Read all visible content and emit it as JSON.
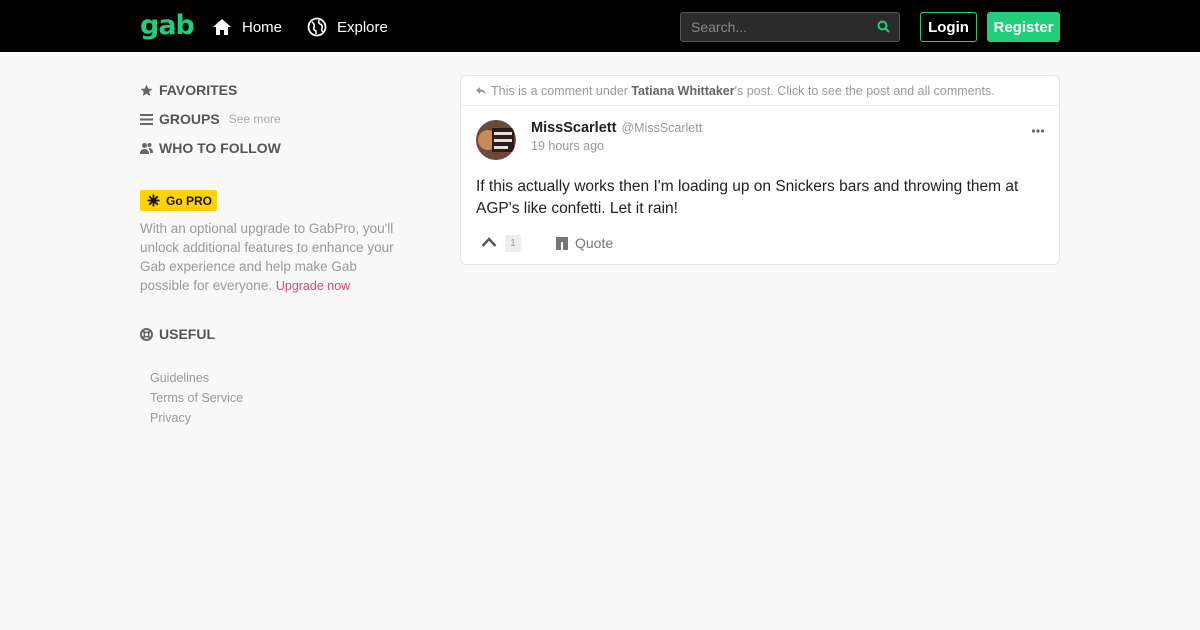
{
  "header": {
    "logo": "gab",
    "nav": [
      {
        "label": "Home",
        "icon": "home-icon"
      },
      {
        "label": "Explore",
        "icon": "globe-icon"
      }
    ],
    "search_placeholder": "Search...",
    "login_label": "Login",
    "register_label": "Register"
  },
  "sidebar": {
    "favorites": "FAVORITES",
    "groups": "GROUPS",
    "see_more": "See more",
    "who_to_follow": "WHO TO FOLLOW",
    "gopro_label": "Go PRO",
    "pro_text": "With an optional upgrade to GabPro, you'll unlock additional features to enhance your Gab experience and help make Gab possible for everyone.",
    "upgrade_link": "Upgrade now",
    "useful": "USEFUL",
    "useful_links": [
      "Guidelines",
      "Terms of Service",
      "Privacy"
    ]
  },
  "post": {
    "note_prefix": "This is a comment under",
    "note_user": "Tatiana Whittaker",
    "note_suffix": "'s post. Click to see the post and all comments.",
    "author_name": "MissScarlett",
    "author_handle": "@MissScarlett",
    "time": "19 hours ago",
    "body": "If this actually works then I'm loading up on Snickers bars and throwing them at AGP's like confetti. Let it rain!",
    "score": "1",
    "quote_label": "Quote"
  },
  "colors": {
    "brand": "#21cf7a",
    "pro_badge": "#ffd400",
    "upgrade_link": "#e0467b"
  }
}
